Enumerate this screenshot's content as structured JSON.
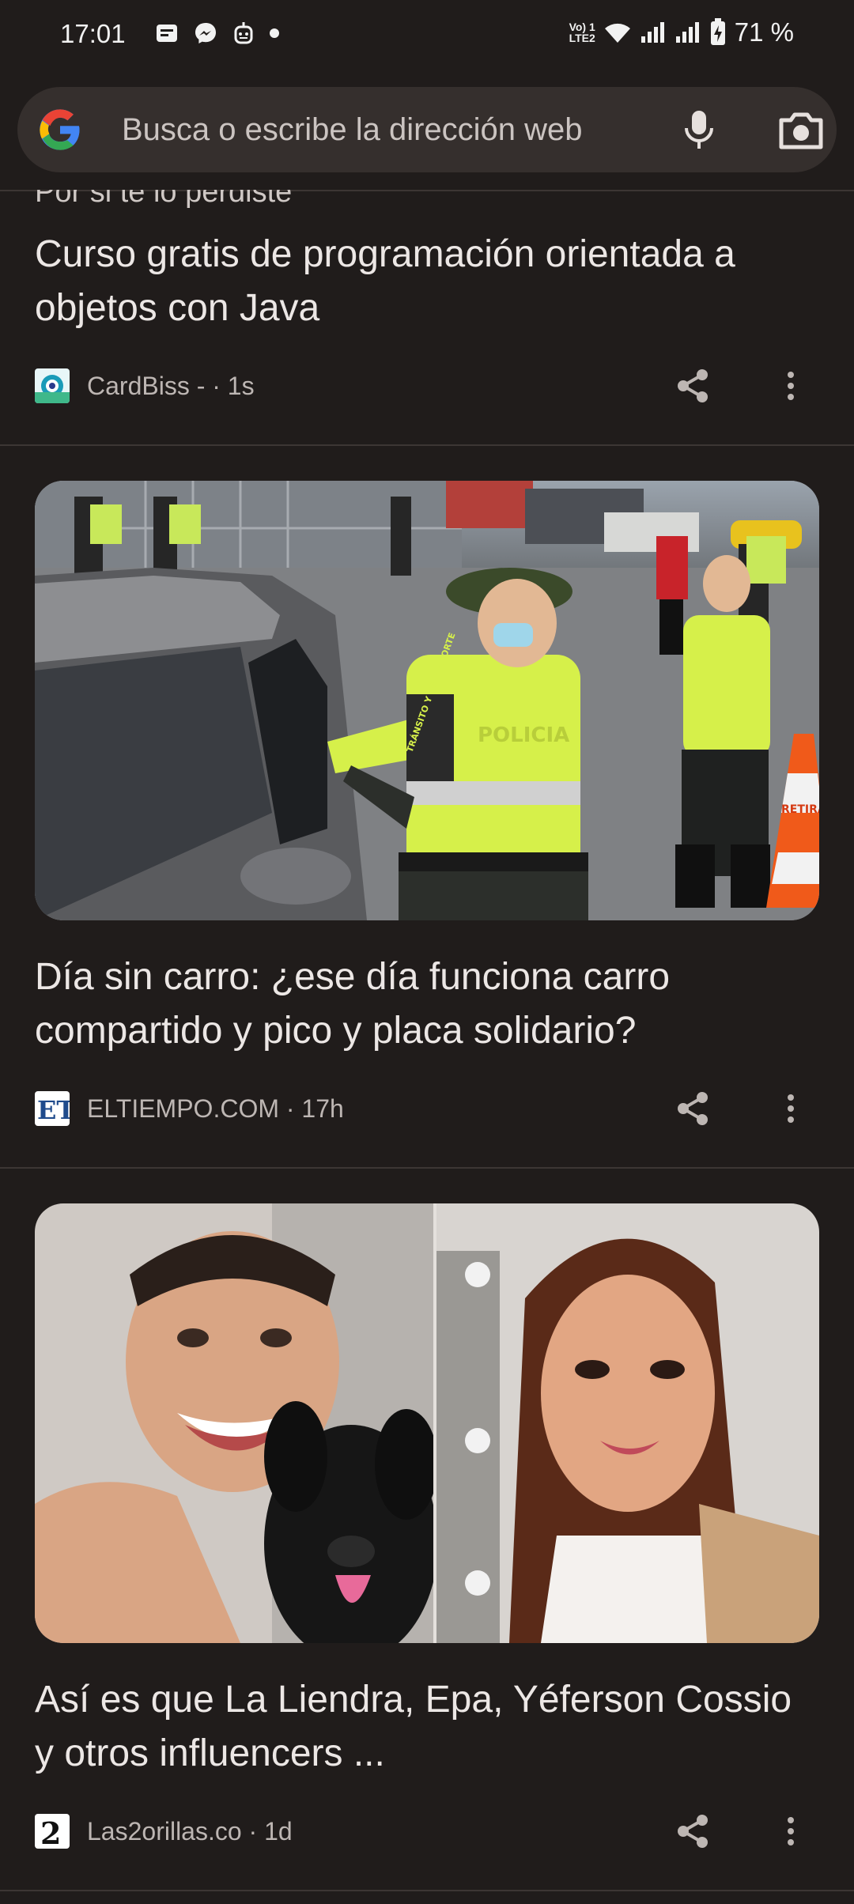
{
  "status_bar": {
    "time": "17:01",
    "network_label_top": "Vo) 1",
    "network_label_bottom": "LTE2",
    "battery": "71 %"
  },
  "search": {
    "placeholder": "Busca o escribe la dirección web"
  },
  "feed": {
    "partial_heading": "Por si te lo perdiste",
    "articles": [
      {
        "title": "Curso gratis de programación orientada a objetos con Java",
        "source_line": "CardBiss - · 1s",
        "logo_color": "#1a9bb8"
      },
      {
        "title": "Día sin carro: ¿ese día funciona carro compartido y pico y placa solidario?",
        "source_line": "ELTIEMPO.COM · 17h",
        "logo_text": "ET",
        "image_text_vest": "POLICIA",
        "image_text_badge": "TRÁNSITO Y TRANSPORTE",
        "image_text_cone": "RETIRA"
      },
      {
        "title": "Así es que La Liendra, Epa, Yéferson Cossio y otros influencers ...",
        "source_line": "Las2orillas.co · 1d",
        "logo_text": "2"
      }
    ]
  },
  "colors": {
    "background": "#201c1b",
    "search_bg": "#352f2d",
    "text_primary": "#ece7e5",
    "text_secondary": "#bdb6b3",
    "divider": "#3c3634"
  },
  "icons": [
    "google-logo",
    "mic-icon",
    "camera-icon",
    "share-icon",
    "more-vert-icon"
  ]
}
